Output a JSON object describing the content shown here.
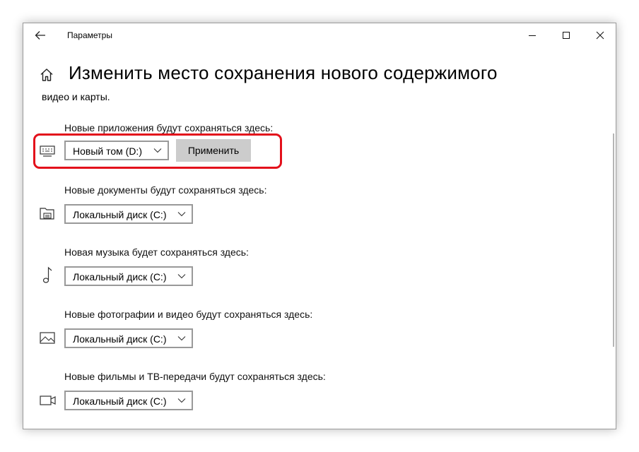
{
  "window": {
    "title": "Параметры",
    "back_icon": "arrow-left-icon",
    "controls": [
      "minimize-icon",
      "maximize-icon",
      "close-icon"
    ]
  },
  "page": {
    "home_icon": "home-icon",
    "title": "Изменить место сохранения нового содержимого",
    "intro": "видео и карты."
  },
  "sections": [
    {
      "label": "Новые приложения будут сохраняться здесь:",
      "icon": "monitor-keyboard-icon",
      "selected": "Новый том (D:)",
      "apply": "Применить"
    },
    {
      "label": "Новые документы будут сохраняться здесь:",
      "icon": "folder-print-icon",
      "selected": "Локальный диск (C:)"
    },
    {
      "label": "Новая музыка будет сохраняться здесь:",
      "icon": "music-note-icon",
      "selected": "Локальный диск (C:)"
    },
    {
      "label": "Новые фотографии и видео будут сохраняться здесь:",
      "icon": "picture-icon",
      "selected": "Локальный диск (C:)"
    },
    {
      "label": "Новые фильмы и ТВ-передачи будут сохраняться здесь:",
      "icon": "video-camera-icon",
      "selected": "Локальный диск (C:)"
    }
  ],
  "colors": {
    "highlight": "#e3101b",
    "apply_button": "#cccccc",
    "dropdown_border": "#999999"
  }
}
